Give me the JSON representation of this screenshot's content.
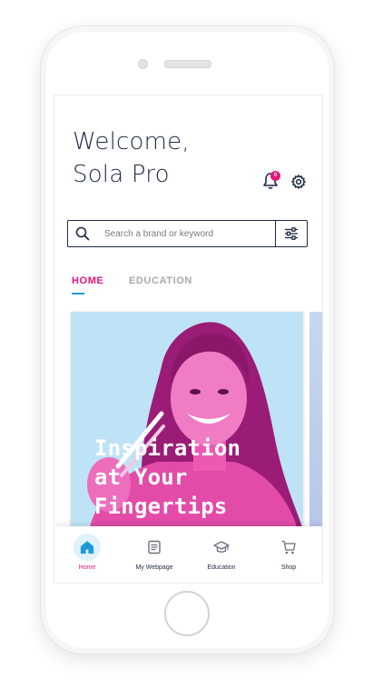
{
  "header": {
    "welcome_line1": "Welcome,",
    "welcome_line2": "Sola Pro"
  },
  "notifications": {
    "count": "0"
  },
  "search": {
    "placeholder": "Search a brand or keyword"
  },
  "tabs": [
    {
      "label": "HOME",
      "active": true
    },
    {
      "label": "EDUCATION",
      "active": false
    }
  ],
  "hero": {
    "line1": "Inspiration",
    "line2": "at Your",
    "line3": "Fingertips"
  },
  "bottom_nav": [
    {
      "label": "Home",
      "icon": "home-icon",
      "active": true
    },
    {
      "label": "My Webpage",
      "icon": "webpage-icon",
      "active": false
    },
    {
      "label": "Education",
      "icon": "graduation-cap-icon",
      "active": false
    },
    {
      "label": "Shop",
      "icon": "cart-icon",
      "active": false
    }
  ],
  "colors": {
    "accent": "#e6157a",
    "navy": "#1f2a44",
    "blue": "#1e9bd7",
    "hero_bg": "#bfe3f6"
  }
}
